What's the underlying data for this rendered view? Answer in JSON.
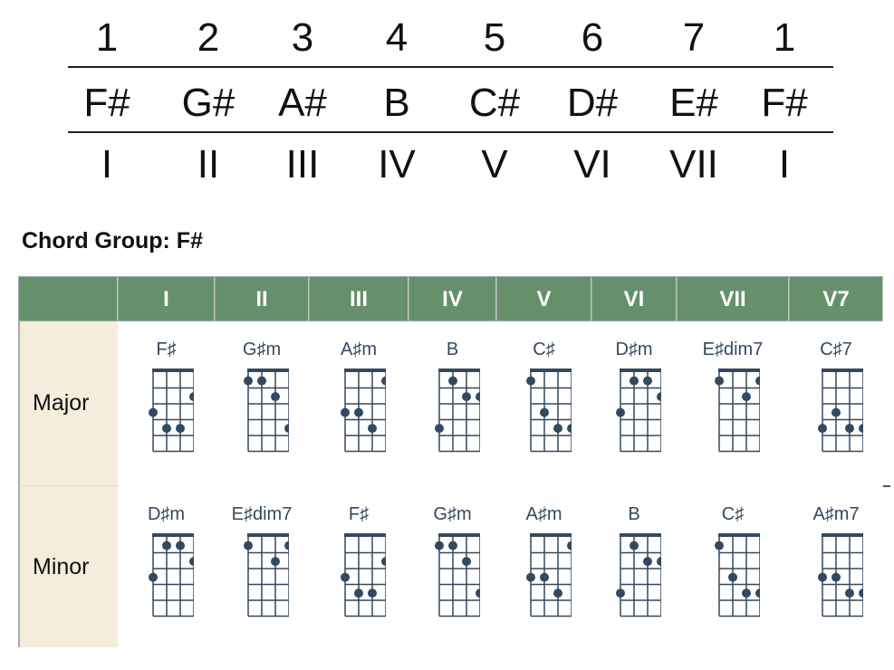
{
  "scale": {
    "degrees": [
      "1",
      "2",
      "3",
      "4",
      "5",
      "6",
      "7",
      "1"
    ],
    "notes": [
      "F#",
      "G#",
      "A#",
      "B",
      "C#",
      "D#",
      "E#",
      "F#"
    ],
    "numerals": [
      "I",
      "II",
      "III",
      "IV",
      "V",
      "VI",
      "VII",
      "I"
    ]
  },
  "title": "Chord Group: F#",
  "table": {
    "headers": [
      "",
      "I",
      "II",
      "III",
      "IV",
      "V",
      "VI",
      "VII",
      "V7"
    ],
    "colors": {
      "header": "#66906c",
      "rowlabel": "#f5eddc",
      "diagram": "#34495e"
    },
    "rows": [
      {
        "label": "Major",
        "chords": [
          {
            "name": "F♯",
            "dots": [
              [
                4,
                2
              ],
              [
                1,
                3
              ],
              [
                2,
                4
              ],
              [
                3,
                4
              ]
            ]
          },
          {
            "name": "G♯m",
            "dots": [
              [
                1,
                1
              ],
              [
                2,
                1
              ],
              [
                3,
                2
              ],
              [
                4,
                4
              ]
            ]
          },
          {
            "name": "A♯m",
            "dots": [
              [
                4,
                1
              ],
              [
                1,
                3
              ],
              [
                2,
                3
              ],
              [
                3,
                4
              ]
            ]
          },
          {
            "name": "B",
            "dots": [
              [
                2,
                1
              ],
              [
                3,
                2
              ],
              [
                4,
                2
              ],
              [
                1,
                4
              ]
            ]
          },
          {
            "name": "C♯",
            "dots": [
              [
                1,
                1
              ],
              [
                2,
                3
              ],
              [
                3,
                4
              ],
              [
                4,
                4
              ]
            ]
          },
          {
            "name": "D♯m",
            "dots": [
              [
                2,
                1
              ],
              [
                3,
                1
              ],
              [
                4,
                2
              ],
              [
                1,
                3
              ]
            ]
          },
          {
            "name": "E♯dim7",
            "dots": [
              [
                1,
                1
              ],
              [
                4,
                1
              ],
              [
                3,
                2
              ]
            ]
          },
          {
            "name": "C♯7",
            "dots": [
              [
                2,
                3
              ],
              [
                1,
                4
              ],
              [
                3,
                4
              ],
              [
                4,
                4
              ]
            ]
          }
        ]
      },
      {
        "label": "Minor",
        "chords": [
          {
            "name": "D♯m",
            "dots": [
              [
                2,
                1
              ],
              [
                3,
                1
              ],
              [
                4,
                2
              ],
              [
                1,
                3
              ]
            ]
          },
          {
            "name": "E♯dim7",
            "dots": [
              [
                1,
                1
              ],
              [
                4,
                1
              ],
              [
                3,
                2
              ]
            ]
          },
          {
            "name": "F♯",
            "dots": [
              [
                4,
                2
              ],
              [
                1,
                3
              ],
              [
                2,
                4
              ],
              [
                3,
                4
              ]
            ]
          },
          {
            "name": "G♯m",
            "dots": [
              [
                1,
                1
              ],
              [
                2,
                1
              ],
              [
                3,
                2
              ],
              [
                4,
                4
              ]
            ]
          },
          {
            "name": "A♯m",
            "dots": [
              [
                4,
                1
              ],
              [
                1,
                3
              ],
              [
                2,
                3
              ],
              [
                3,
                4
              ]
            ]
          },
          {
            "name": "B",
            "dots": [
              [
                2,
                1
              ],
              [
                3,
                2
              ],
              [
                4,
                2
              ],
              [
                1,
                4
              ]
            ]
          },
          {
            "name": "C♯",
            "dots": [
              [
                1,
                1
              ],
              [
                2,
                3
              ],
              [
                3,
                4
              ],
              [
                4,
                4
              ]
            ]
          },
          {
            "name": "A♯m7",
            "dots": [
              [
                1,
                3
              ],
              [
                2,
                3
              ],
              [
                3,
                4
              ],
              [
                4,
                4
              ]
            ]
          }
        ]
      }
    ]
  }
}
